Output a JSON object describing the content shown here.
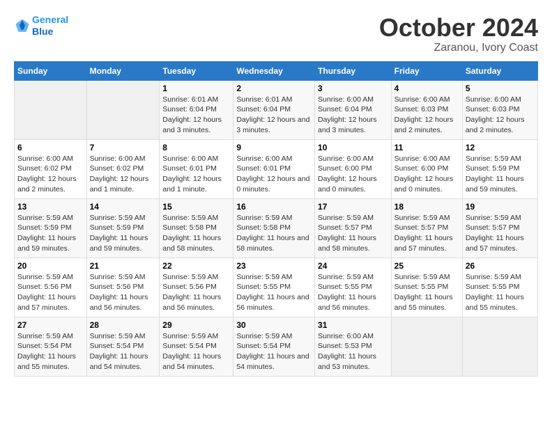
{
  "logo": {
    "line1": "General",
    "line2": "Blue"
  },
  "title": "October 2024",
  "subtitle": "Zaranou, Ivory Coast",
  "headers": [
    "Sunday",
    "Monday",
    "Tuesday",
    "Wednesday",
    "Thursday",
    "Friday",
    "Saturday"
  ],
  "weeks": [
    [
      {
        "day": "",
        "info": ""
      },
      {
        "day": "",
        "info": ""
      },
      {
        "day": "1",
        "info": "Sunrise: 6:01 AM\nSunset: 6:04 PM\nDaylight: 12 hours and 3 minutes."
      },
      {
        "day": "2",
        "info": "Sunrise: 6:01 AM\nSunset: 6:04 PM\nDaylight: 12 hours and 3 minutes."
      },
      {
        "day": "3",
        "info": "Sunrise: 6:00 AM\nSunset: 6:04 PM\nDaylight: 12 hours and 3 minutes."
      },
      {
        "day": "4",
        "info": "Sunrise: 6:00 AM\nSunset: 6:03 PM\nDaylight: 12 hours and 2 minutes."
      },
      {
        "day": "5",
        "info": "Sunrise: 6:00 AM\nSunset: 6:03 PM\nDaylight: 12 hours and 2 minutes."
      }
    ],
    [
      {
        "day": "6",
        "info": "Sunrise: 6:00 AM\nSunset: 6:02 PM\nDaylight: 12 hours and 2 minutes."
      },
      {
        "day": "7",
        "info": "Sunrise: 6:00 AM\nSunset: 6:02 PM\nDaylight: 12 hours and 1 minute."
      },
      {
        "day": "8",
        "info": "Sunrise: 6:00 AM\nSunset: 6:01 PM\nDaylight: 12 hours and 1 minute."
      },
      {
        "day": "9",
        "info": "Sunrise: 6:00 AM\nSunset: 6:01 PM\nDaylight: 12 hours and 0 minutes."
      },
      {
        "day": "10",
        "info": "Sunrise: 6:00 AM\nSunset: 6:00 PM\nDaylight: 12 hours and 0 minutes."
      },
      {
        "day": "11",
        "info": "Sunrise: 6:00 AM\nSunset: 6:00 PM\nDaylight: 12 hours and 0 minutes."
      },
      {
        "day": "12",
        "info": "Sunrise: 5:59 AM\nSunset: 5:59 PM\nDaylight: 11 hours and 59 minutes."
      }
    ],
    [
      {
        "day": "13",
        "info": "Sunrise: 5:59 AM\nSunset: 5:59 PM\nDaylight: 11 hours and 59 minutes."
      },
      {
        "day": "14",
        "info": "Sunrise: 5:59 AM\nSunset: 5:59 PM\nDaylight: 11 hours and 59 minutes."
      },
      {
        "day": "15",
        "info": "Sunrise: 5:59 AM\nSunset: 5:58 PM\nDaylight: 11 hours and 58 minutes."
      },
      {
        "day": "16",
        "info": "Sunrise: 5:59 AM\nSunset: 5:58 PM\nDaylight: 11 hours and 58 minutes."
      },
      {
        "day": "17",
        "info": "Sunrise: 5:59 AM\nSunset: 5:57 PM\nDaylight: 11 hours and 58 minutes."
      },
      {
        "day": "18",
        "info": "Sunrise: 5:59 AM\nSunset: 5:57 PM\nDaylight: 11 hours and 57 minutes."
      },
      {
        "day": "19",
        "info": "Sunrise: 5:59 AM\nSunset: 5:57 PM\nDaylight: 11 hours and 57 minutes."
      }
    ],
    [
      {
        "day": "20",
        "info": "Sunrise: 5:59 AM\nSunset: 5:56 PM\nDaylight: 11 hours and 57 minutes."
      },
      {
        "day": "21",
        "info": "Sunrise: 5:59 AM\nSunset: 5:56 PM\nDaylight: 11 hours and 56 minutes."
      },
      {
        "day": "22",
        "info": "Sunrise: 5:59 AM\nSunset: 5:56 PM\nDaylight: 11 hours and 56 minutes."
      },
      {
        "day": "23",
        "info": "Sunrise: 5:59 AM\nSunset: 5:55 PM\nDaylight: 11 hours and 56 minutes."
      },
      {
        "day": "24",
        "info": "Sunrise: 5:59 AM\nSunset: 5:55 PM\nDaylight: 11 hours and 56 minutes."
      },
      {
        "day": "25",
        "info": "Sunrise: 5:59 AM\nSunset: 5:55 PM\nDaylight: 11 hours and 55 minutes."
      },
      {
        "day": "26",
        "info": "Sunrise: 5:59 AM\nSunset: 5:55 PM\nDaylight: 11 hours and 55 minutes."
      }
    ],
    [
      {
        "day": "27",
        "info": "Sunrise: 5:59 AM\nSunset: 5:54 PM\nDaylight: 11 hours and 55 minutes."
      },
      {
        "day": "28",
        "info": "Sunrise: 5:59 AM\nSunset: 5:54 PM\nDaylight: 11 hours and 54 minutes."
      },
      {
        "day": "29",
        "info": "Sunrise: 5:59 AM\nSunset: 5:54 PM\nDaylight: 11 hours and 54 minutes."
      },
      {
        "day": "30",
        "info": "Sunrise: 5:59 AM\nSunset: 5:54 PM\nDaylight: 11 hours and 54 minutes."
      },
      {
        "day": "31",
        "info": "Sunrise: 6:00 AM\nSunset: 5:53 PM\nDaylight: 11 hours and 53 minutes."
      },
      {
        "day": "",
        "info": ""
      },
      {
        "day": "",
        "info": ""
      }
    ]
  ]
}
